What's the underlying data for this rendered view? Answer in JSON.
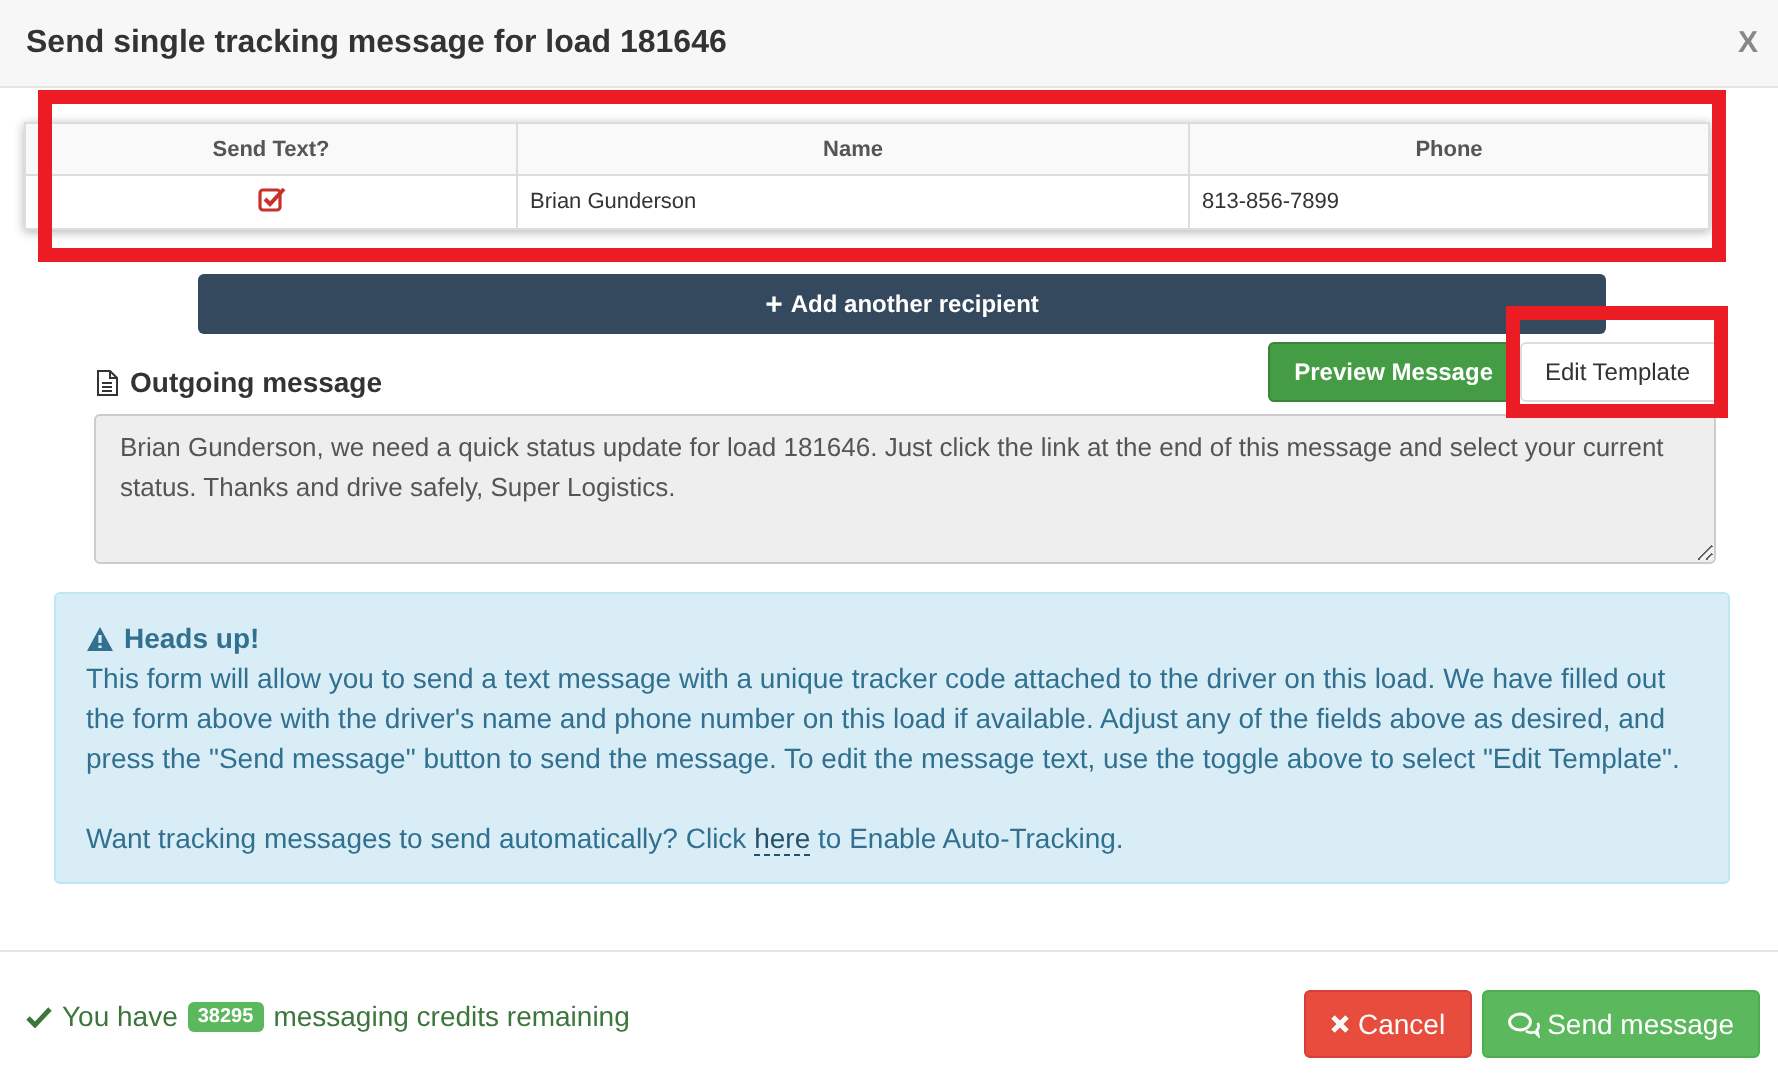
{
  "dialog": {
    "title": "Send single tracking message for load 181646",
    "close_label": "X"
  },
  "recipients": {
    "highlighted": true,
    "columns": [
      "Send Text?",
      "Name",
      "Phone"
    ],
    "rows": [
      {
        "checked": true,
        "name": "Brian Gunderson",
        "phone": "813-856-7899"
      }
    ]
  },
  "add_button": {
    "icon": "+",
    "label": "Add another recipient"
  },
  "message": {
    "label": "Outgoing message",
    "text": "Brian Gunderson, we need a quick status update for load 181646. Just click the link at the end of this message and select your current status. Thanks and drive safely, Super Logistics.",
    "toggle": {
      "highlighted": true,
      "options": [
        {
          "label": "Preview Message",
          "selected": true
        },
        {
          "label": "Edit Template",
          "selected": false
        }
      ]
    }
  },
  "alert": {
    "title": "Heads up!",
    "body": "This form will allow you to send a text message with a unique tracker code attached to the driver on this load. We have filled out the form above with the driver's name and phone number on this load if available. Adjust any of the fields above as desired, and press the \"Send message\" button to send the message. To edit the message text, use the toggle above to select \"Edit Template\".",
    "auto_before": "Want tracking messages to send automatically? Click",
    "auto_link": "here",
    "auto_after": "to Enable Auto-Tracking."
  },
  "footer": {
    "credits_before": "You have",
    "credits": "38295",
    "credits_after": "messaging credits remaining",
    "buttons": [
      {
        "kind": "cancel",
        "label": "Cancel"
      },
      {
        "kind": "send",
        "label": "Send message"
      }
    ]
  }
}
